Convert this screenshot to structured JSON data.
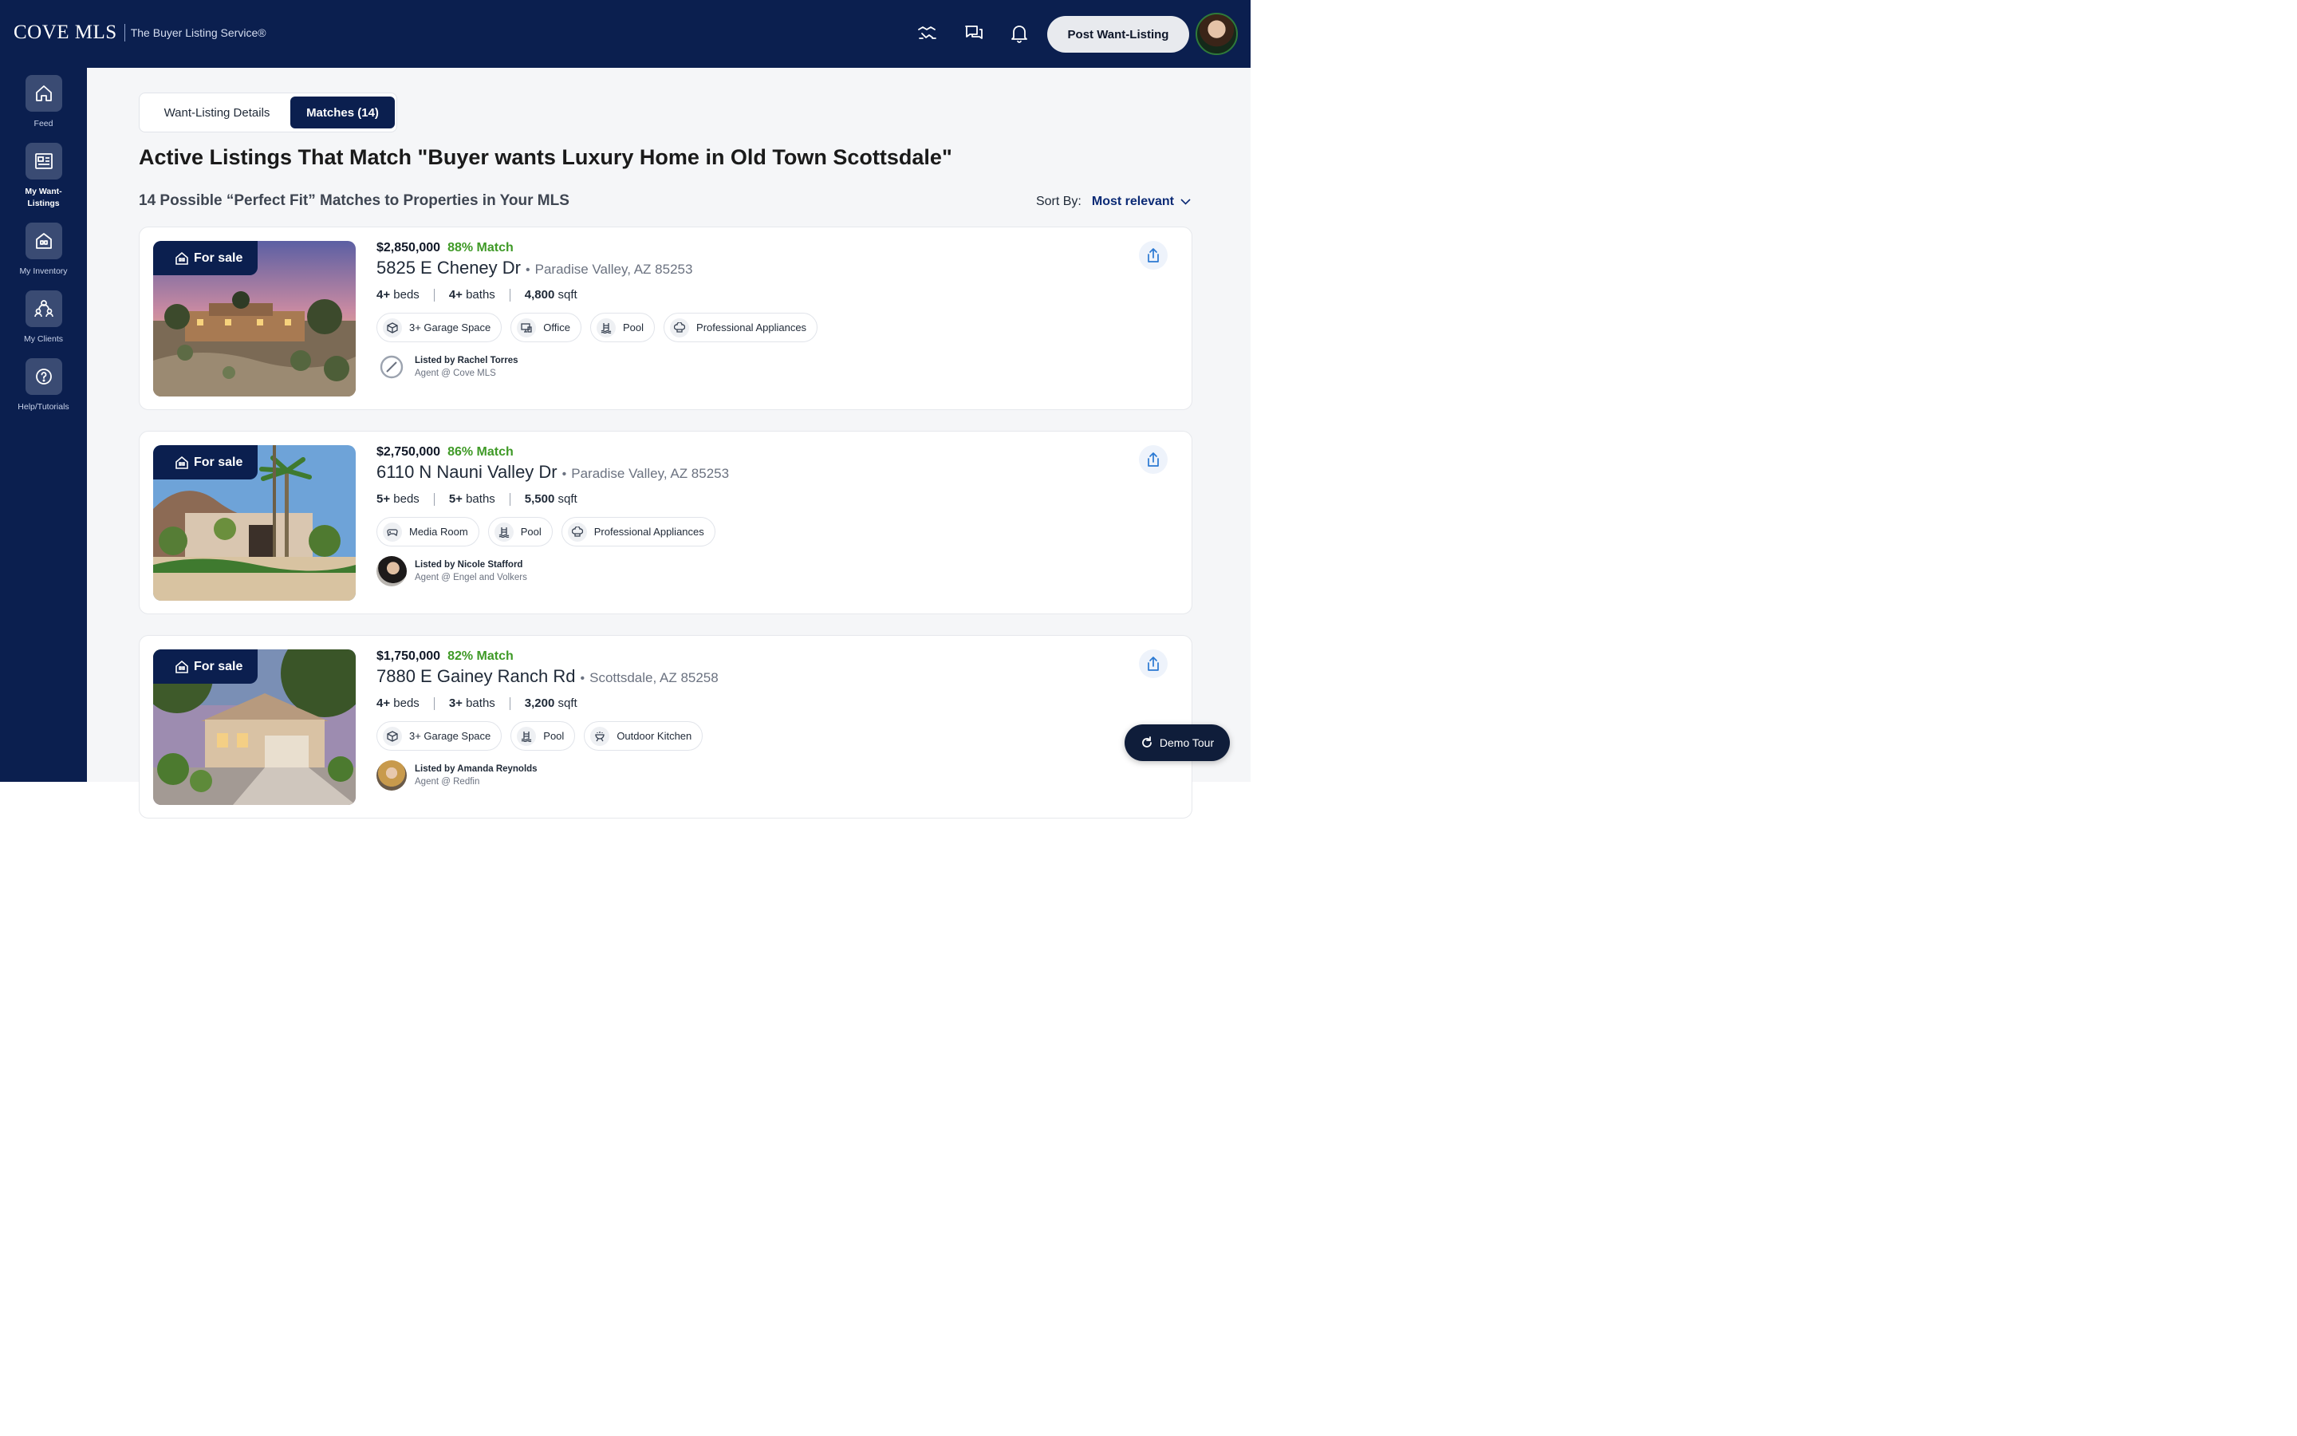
{
  "brand": {
    "logo": "COVE MLS",
    "tagline": "The Buyer Listing Service®"
  },
  "header": {
    "post_button": "Post Want-Listing"
  },
  "sidebar": {
    "items": [
      {
        "label": "Feed",
        "icon": "home-icon"
      },
      {
        "label": "My Want-Listings",
        "icon": "listing-icon",
        "active": true
      },
      {
        "label": "My Inventory",
        "icon": "inventory-icon"
      },
      {
        "label": "My Clients",
        "icon": "clients-icon"
      },
      {
        "label": "Help/Tutorials",
        "icon": "help-icon"
      }
    ]
  },
  "tabs": {
    "details": "Want-Listing Details",
    "matches": "Matches (14)"
  },
  "page": {
    "title": "Active Listings That Match \"Buyer wants Luxury Home in Old Town Scottsdale\"",
    "subtitle": "14 Possible “Perfect Fit” Matches to Properties in Your MLS",
    "sort_label": "Sort By:",
    "sort_value": "Most relevant"
  },
  "listings": [
    {
      "badge": "For sale",
      "price": "$2,850,000",
      "match": "88% Match",
      "street": "5825 E Cheney Dr",
      "city": "Paradise Valley, AZ 85253",
      "beds": "4+",
      "beds_label": "beds",
      "baths": "4+",
      "baths_label": "baths",
      "sqft": "4,800",
      "sqft_label": "sqft",
      "features": [
        "3+ Garage Space",
        "Office",
        "Pool",
        "Professional Appliances"
      ],
      "agent_name": "Listed by Rachel Torres",
      "agent_org": "Agent @ Cove MLS"
    },
    {
      "badge": "For sale",
      "price": "$2,750,000",
      "match": "86% Match",
      "street": "6110 N Nauni Valley Dr",
      "city": "Paradise Valley, AZ 85253",
      "beds": "5+",
      "beds_label": "beds",
      "baths": "5+",
      "baths_label": "baths",
      "sqft": "5,500",
      "sqft_label": "sqft",
      "features": [
        "Media Room",
        "Pool",
        "Professional Appliances"
      ],
      "agent_name": "Listed by Nicole Stafford",
      "agent_org": "Agent @ Engel and Volkers"
    },
    {
      "badge": "For sale",
      "price": "$1,750,000",
      "match": "82% Match",
      "street": "7880 E Gainey Ranch Rd",
      "city": "Scottsdale, AZ 85258",
      "beds": "4+",
      "beds_label": "beds",
      "baths": "3+",
      "baths_label": "baths",
      "sqft": "3,200",
      "sqft_label": "sqft",
      "features": [
        "3+ Garage Space",
        "Pool",
        "Outdoor Kitchen"
      ],
      "agent_name": "Listed by Amanda Reynolds",
      "agent_org": "Agent @ Redfin"
    }
  ],
  "demo_tour": "Demo Tour",
  "colors": {
    "navy": "#0b1f4f",
    "match_green": "#3f9a27",
    "accent_blue": "#0b2a75"
  }
}
